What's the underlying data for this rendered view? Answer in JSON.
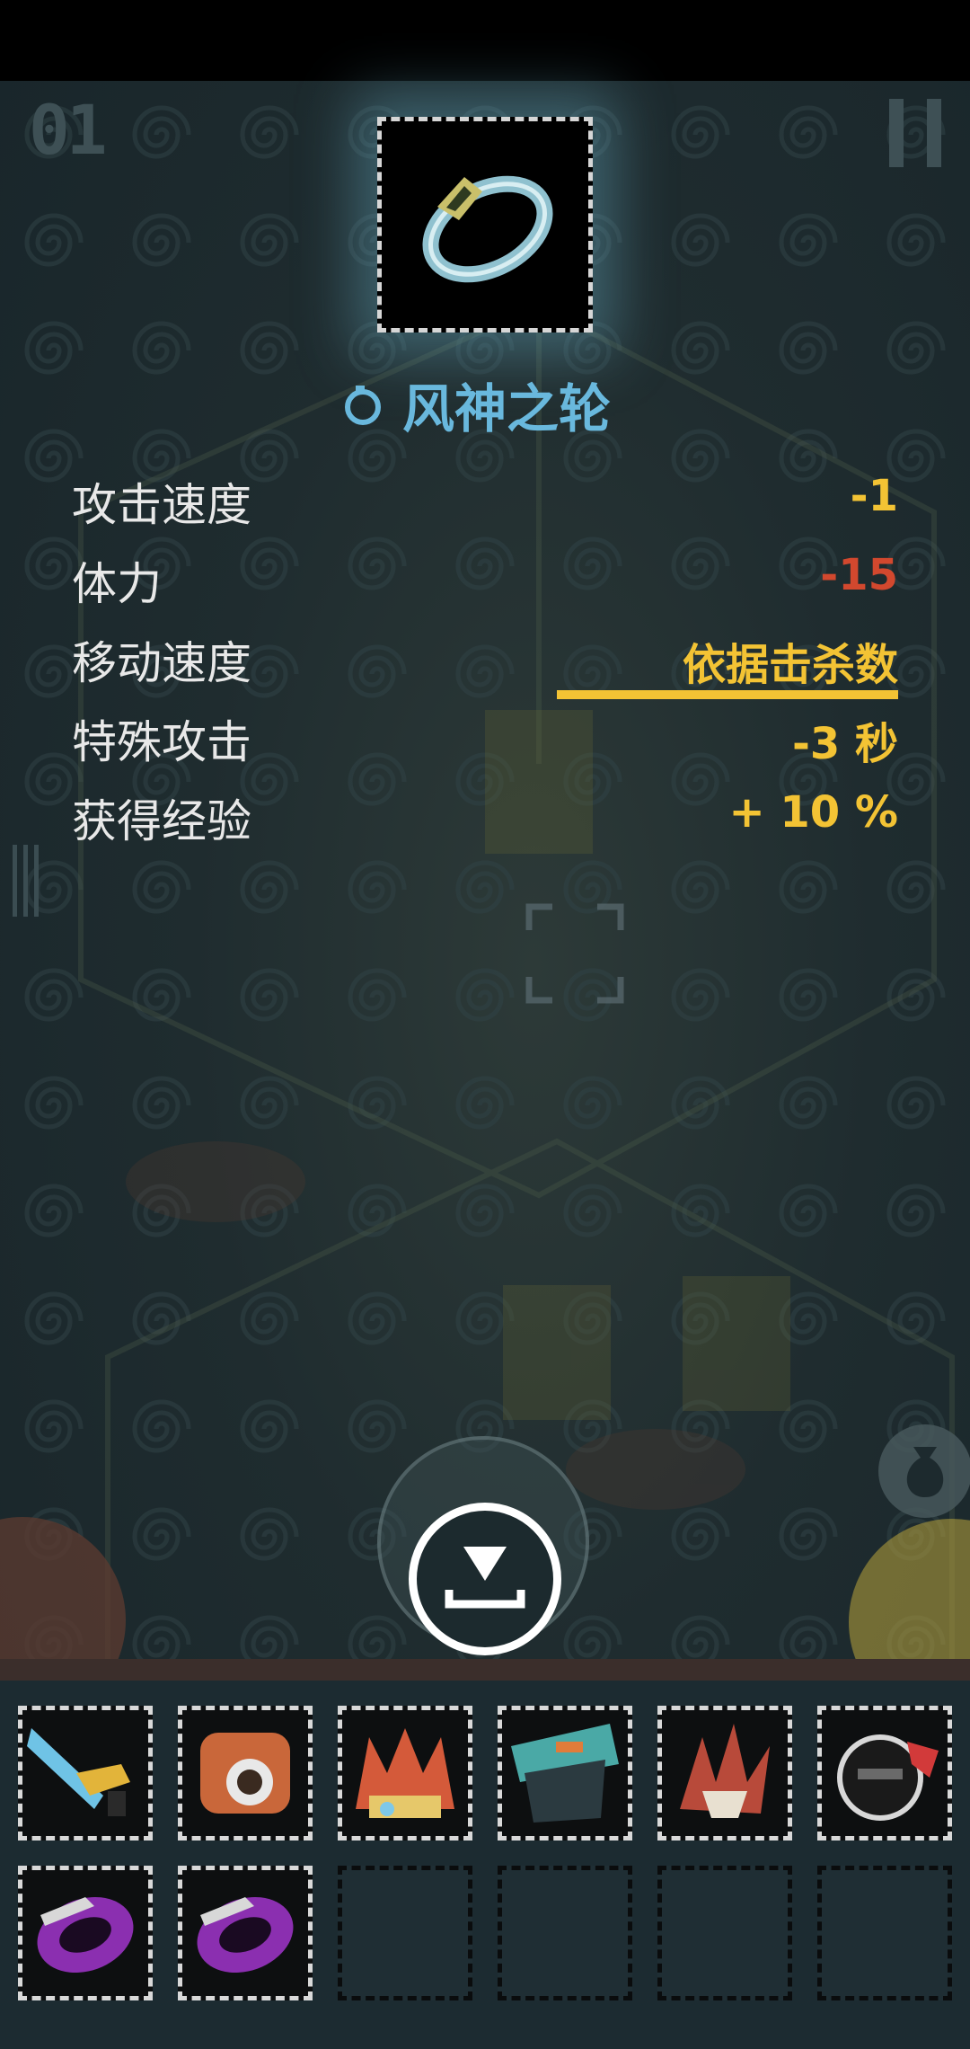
{
  "hud": {
    "floor_number": "01"
  },
  "item": {
    "name": "风神之轮",
    "icon": "wind-ring-icon"
  },
  "stats": [
    {
      "label": "攻击速度",
      "value": "-1",
      "color": "#f3c334"
    },
    {
      "label": "体力",
      "value": "-15",
      "color": "#d2482e"
    },
    {
      "label": "移动速度",
      "value": "依据击杀数",
      "color": "#f3c334"
    },
    {
      "label": "特殊攻击",
      "value": "-3 秒",
      "color": "#f3c334"
    },
    {
      "label": "获得经验",
      "value": "+ 10 %",
      "color": "#f3c334"
    }
  ],
  "actions": {
    "drop_icon": "drop-down-icon",
    "bag_icon": "money-bag-icon"
  },
  "inventory": {
    "rows": [
      [
        "blue-blade-icon",
        "orange-gear-icon",
        "spiked-crown-icon",
        "teal-armor-icon",
        "red-claw-icon",
        "black-helmet-icon"
      ],
      [
        "purple-ring-icon",
        "purple-ring-icon",
        "empty",
        "empty",
        "empty",
        "empty"
      ]
    ]
  },
  "colors": {
    "accent_blue": "#69b8dd",
    "stat_yellow": "#f3c334",
    "stat_red": "#d2482e"
  }
}
